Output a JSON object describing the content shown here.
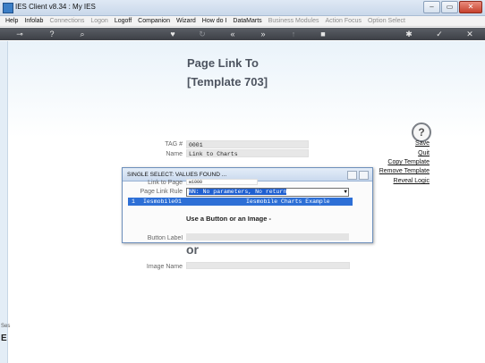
{
  "window": {
    "title": "IES Client v8.34 : My IES",
    "controls": [
      "–",
      "▭",
      "✕"
    ]
  },
  "menu": {
    "items": [
      {
        "label": "Help",
        "enabled": true
      },
      {
        "label": "Infolab",
        "enabled": true
      },
      {
        "label": "Connections",
        "enabled": false
      },
      {
        "label": "Logon",
        "enabled": false
      },
      {
        "label": "Logoff",
        "enabled": true
      },
      {
        "label": "Companion",
        "enabled": true
      },
      {
        "label": "Wizard",
        "enabled": true
      },
      {
        "label": "How do I",
        "enabled": true
      },
      {
        "label": "DataMarts",
        "enabled": true
      },
      {
        "label": "Business Modules",
        "enabled": false
      },
      {
        "label": "Action Focus",
        "enabled": false
      },
      {
        "label": "Option Select",
        "enabled": false
      }
    ]
  },
  "toolbar": {
    "icons": [
      {
        "name": "key-icon",
        "glyph": "⊸",
        "enabled": true
      },
      {
        "name": "help-icon",
        "glyph": "?",
        "enabled": true
      },
      {
        "name": "search-icon",
        "glyph": "⌕",
        "enabled": true
      },
      {
        "name": "heart-icon",
        "glyph": "♥",
        "enabled": true
      },
      {
        "name": "refresh-icon",
        "glyph": "↻",
        "enabled": false
      },
      {
        "name": "rewind-icon",
        "glyph": "«",
        "enabled": true
      },
      {
        "name": "forward-icon",
        "glyph": "»",
        "enabled": true
      },
      {
        "name": "upload-icon",
        "glyph": "↑",
        "enabled": false
      },
      {
        "name": "stop-icon",
        "glyph": "■",
        "enabled": true
      },
      {
        "name": "settings-icon",
        "glyph": "✱",
        "enabled": true
      },
      {
        "name": "check-icon",
        "glyph": "✓",
        "enabled": true
      },
      {
        "name": "close-icon",
        "glyph": "✕",
        "enabled": true
      }
    ]
  },
  "page": {
    "title": "Page Link To",
    "subtitle": "[Template 703]"
  },
  "form": {
    "tag_label": "TAG #",
    "tag_value": "0001",
    "name_label": "Name",
    "name_value": "Link to Charts",
    "image_name_label": "Image Name",
    "image_name_value": "",
    "or_text": "or"
  },
  "actions": {
    "save": "Save",
    "quit": "Quit",
    "copy_template": "Copy Template",
    "remove_template": "Remove Template",
    "reveal_logic": "Reveal Logic"
  },
  "dialog": {
    "title": "SINGLE SELECT: VALUES FOUND ...",
    "link_to_page_label": "Link to Page",
    "link_to_page_value": "w1000",
    "page_link_rule_label": "Page Link Rule",
    "page_link_rule_value": "NN: No parameters, No return",
    "result": {
      "index": "1",
      "code": "Iesmobile01",
      "description": "Iesmobile Charts Example"
    },
    "body_text": "Use a Button or an Image -",
    "button_label": "Button Label"
  },
  "left_panel": {
    "ses_label": "Ses",
    "e_label": "E"
  }
}
